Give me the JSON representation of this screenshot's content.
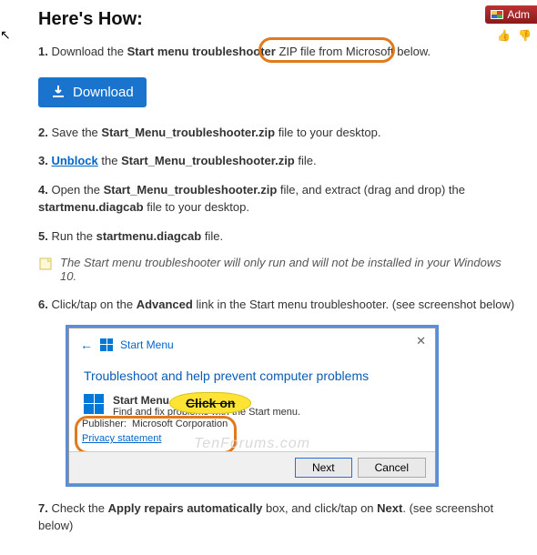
{
  "header": {
    "title": "Here's How:"
  },
  "badge": {
    "text": "Adm"
  },
  "thumbs": {
    "up": "👍",
    "down": "👎"
  },
  "download_button": "Download",
  "steps": {
    "s1": {
      "num": "1.",
      "pre": "Download the ",
      "bold": "Start menu troubleshooter",
      "post": " ZIP file from Microsoft below."
    },
    "s2": {
      "num": "2.",
      "pre": "Save the ",
      "bold": "Start_Menu_troubleshooter.zip",
      "post": " file to your desktop."
    },
    "s3": {
      "num": "3.",
      "link": "Unblock",
      "mid": " the ",
      "bold": "Start_Menu_troubleshooter.zip",
      "post": " file."
    },
    "s4": {
      "num": "4.",
      "pre": "Open the ",
      "bold": "Start_Menu_troubleshooter.zip",
      "mid": " file, and extract (drag and drop) the ",
      "bold2": "startmenu.diagcab",
      "post": " file to your desktop."
    },
    "s5": {
      "num": "5.",
      "pre": "Run the ",
      "bold": "startmenu.diagcab",
      "post": " file."
    },
    "s6": {
      "num": "6.",
      "pre": "Click/tap on the ",
      "bold": "Advanced",
      "post": " link in the Start menu troubleshooter. (see screenshot below)"
    },
    "s7": {
      "num": "7.",
      "pre": "Check the ",
      "bold": "Apply repairs automatically",
      "mid": " box, and click/tap on ",
      "bold2": "Next",
      "post": ". (see screenshot below)"
    }
  },
  "note": "The Start menu troubleshooter will only run and will not be installed in your Windows 10.",
  "dialog": {
    "title_small": "Start Menu",
    "heading": "Troubleshoot and help prevent computer problems",
    "item_title": "Start Menu",
    "item_sub": "Find and fix problems with the Start menu.",
    "publisher_label": "Publisher:",
    "publisher_value": "Microsoft Corporation",
    "privacy": "Privacy statement",
    "next": "Next",
    "cancel": "Cancel",
    "click_on": "Click on"
  },
  "watermark": "TenForums.com"
}
